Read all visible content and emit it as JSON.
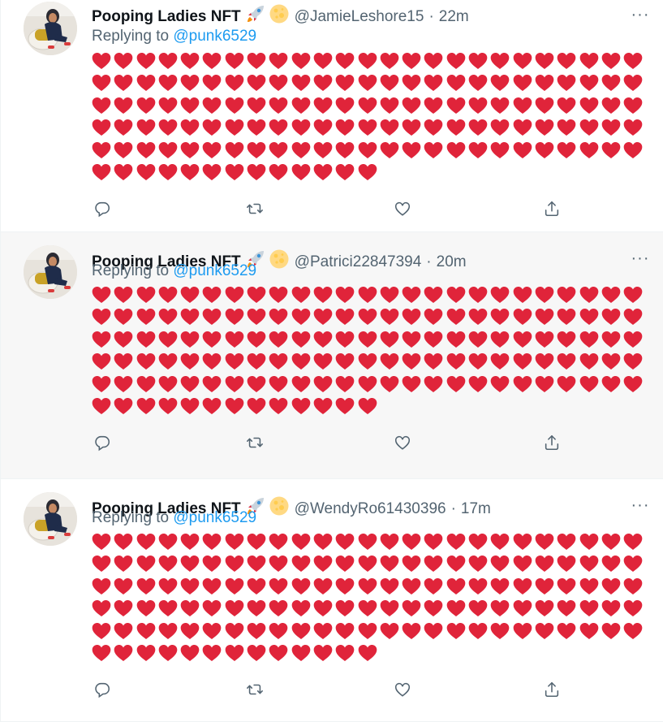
{
  "colors": {
    "heart": "#e0243a",
    "name": "#0f1419",
    "secondary": "#536471",
    "link": "#1d9bf0",
    "highlight_bg": "#f7f7f7"
  },
  "icons": {
    "reply": "reply-icon",
    "retweet": "retweet-icon",
    "like": "like-icon",
    "share": "share-icon",
    "more": "more-icon",
    "badge_1": "rocket-icon",
    "badge_2": "moon-icon",
    "heart": "red-heart-icon"
  },
  "tweets": [
    {
      "name": "Pooping Ladies NFT",
      "handle": "@JamieLeshore15",
      "dot": "·",
      "time": "22m",
      "replying_prefix": "Replying to",
      "replying_to": "@punk6529",
      "heart_rows": [
        25,
        25,
        25,
        25,
        25,
        13
      ],
      "more_label": "···"
    },
    {
      "name": "Pooping Ladies NFT",
      "handle": "@Patrici22847394",
      "dot": "·",
      "time": "20m",
      "replying_prefix": "Replying to",
      "replying_to": "@punk6529",
      "heart_rows": [
        25,
        25,
        25,
        25,
        25,
        13
      ],
      "more_label": "···"
    },
    {
      "name": "Pooping Ladies NFT",
      "handle": "@WendyRo61430396",
      "dot": "·",
      "time": "17m",
      "replying_prefix": "Replying to",
      "replying_to": "@punk6529",
      "heart_rows": [
        25,
        25,
        25,
        25,
        25,
        13
      ],
      "more_label": "···"
    }
  ]
}
